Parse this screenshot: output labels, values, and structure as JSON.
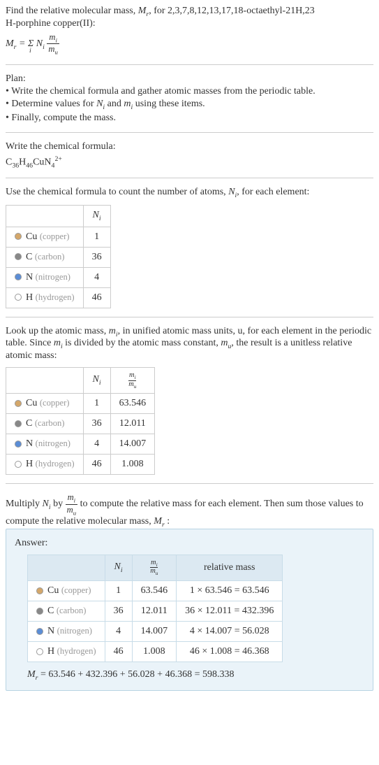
{
  "intro": {
    "line1": "Find the relative molecular mass, ",
    "mr": "M",
    "mr_sub": "r",
    "line1b": ", for 2,3,7,8,12,13,17,18-octaethyl-21H,23",
    "line2": "H-porphine copper(II):",
    "eq_lhs_M": "M",
    "eq_lhs_sub": "r",
    "eq_equals": " = ",
    "eq_sum": "Σ",
    "eq_sum_sub": "i",
    "eq_Ni_N": "N",
    "eq_Ni_i": "i",
    "eq_frac_num_m": "m",
    "eq_frac_num_i": "i",
    "eq_frac_den_m": "m",
    "eq_frac_den_u": "u"
  },
  "plan": {
    "title": "Plan:",
    "b1": "• Write the chemical formula and gather atomic masses from the periodic table.",
    "b2_a": "• Determine values for ",
    "b2_N": "N",
    "b2_i": "i",
    "b2_b": " and ",
    "b2_m": "m",
    "b2_mi": "i",
    "b2_c": " using these items.",
    "b3": "• Finally, compute the mass."
  },
  "step1": {
    "title": "Write the chemical formula:",
    "C": "C",
    "C_n": "36",
    "H": "H",
    "H_n": "46",
    "Cu": "Cu",
    "N": "N",
    "N_n": "4",
    "charge": "2+"
  },
  "step2": {
    "title_a": "Use the chemical formula to count the number of atoms, ",
    "N": "N",
    "Ni": "i",
    "title_b": ", for each element:",
    "header_blank": "",
    "header_Ni_N": "N",
    "header_Ni_i": "i",
    "rows": [
      {
        "sym": "Cu",
        "name": "(copper)",
        "dot": "dot-cu",
        "n": "1"
      },
      {
        "sym": "C",
        "name": "(carbon)",
        "dot": "dot-c",
        "n": "36"
      },
      {
        "sym": "N",
        "name": "(nitrogen)",
        "dot": "dot-n",
        "n": "4"
      },
      {
        "sym": "H",
        "name": "(hydrogen)",
        "dot": "dot-h",
        "n": "46"
      }
    ]
  },
  "step3": {
    "p1_a": "Look up the atomic mass, ",
    "m": "m",
    "mi": "i",
    "p1_b": ", in unified atomic mass units, u, for each element in the periodic table. Since ",
    "p1_c": " is divided by the atomic mass constant, ",
    "mu_m": "m",
    "mu_u": "u",
    "p1_d": ", the result is a unitless relative atomic mass:",
    "header_Ni_N": "N",
    "header_Ni_i": "i",
    "header_frac_num_m": "m",
    "header_frac_num_i": "i",
    "header_frac_den_m": "m",
    "header_frac_den_u": "u",
    "rows": [
      {
        "sym": "Cu",
        "name": "(copper)",
        "dot": "dot-cu",
        "n": "1",
        "mass": "63.546"
      },
      {
        "sym": "C",
        "name": "(carbon)",
        "dot": "dot-c",
        "n": "36",
        "mass": "12.011"
      },
      {
        "sym": "N",
        "name": "(nitrogen)",
        "dot": "dot-n",
        "n": "4",
        "mass": "14.007"
      },
      {
        "sym": "H",
        "name": "(hydrogen)",
        "dot": "dot-h",
        "n": "46",
        "mass": "1.008"
      }
    ]
  },
  "step4": {
    "p_a": "Multiply ",
    "N": "N",
    "Ni": "i",
    "p_b": " by ",
    "frac_num_m": "m",
    "frac_num_i": "i",
    "frac_den_m": "m",
    "frac_den_u": "u",
    "p_c": " to compute the relative mass for each element. Then sum those values to compute the relative molecular mass, ",
    "Mr_M": "M",
    "Mr_r": "r",
    "p_d": " :"
  },
  "answer": {
    "title": "Answer:",
    "header_Ni_N": "N",
    "header_Ni_i": "i",
    "header_frac_num_m": "m",
    "header_frac_num_i": "i",
    "header_frac_den_m": "m",
    "header_frac_den_u": "u",
    "header_relmass": "relative mass",
    "rows": [
      {
        "sym": "Cu",
        "name": "(copper)",
        "dot": "dot-cu",
        "n": "1",
        "mass": "63.546",
        "rel": "1 × 63.546 = 63.546"
      },
      {
        "sym": "C",
        "name": "(carbon)",
        "dot": "dot-c",
        "n": "36",
        "mass": "12.011",
        "rel": "36 × 12.011 = 432.396"
      },
      {
        "sym": "N",
        "name": "(nitrogen)",
        "dot": "dot-n",
        "n": "4",
        "mass": "14.007",
        "rel": "4 × 14.007 = 56.028"
      },
      {
        "sym": "H",
        "name": "(hydrogen)",
        "dot": "dot-h",
        "n": "46",
        "mass": "1.008",
        "rel": "46 × 1.008 = 46.368"
      }
    ],
    "final_M": "M",
    "final_r": "r",
    "final_eq": " = 63.546 + 432.396 + 56.028 + 46.368 = 598.338"
  }
}
